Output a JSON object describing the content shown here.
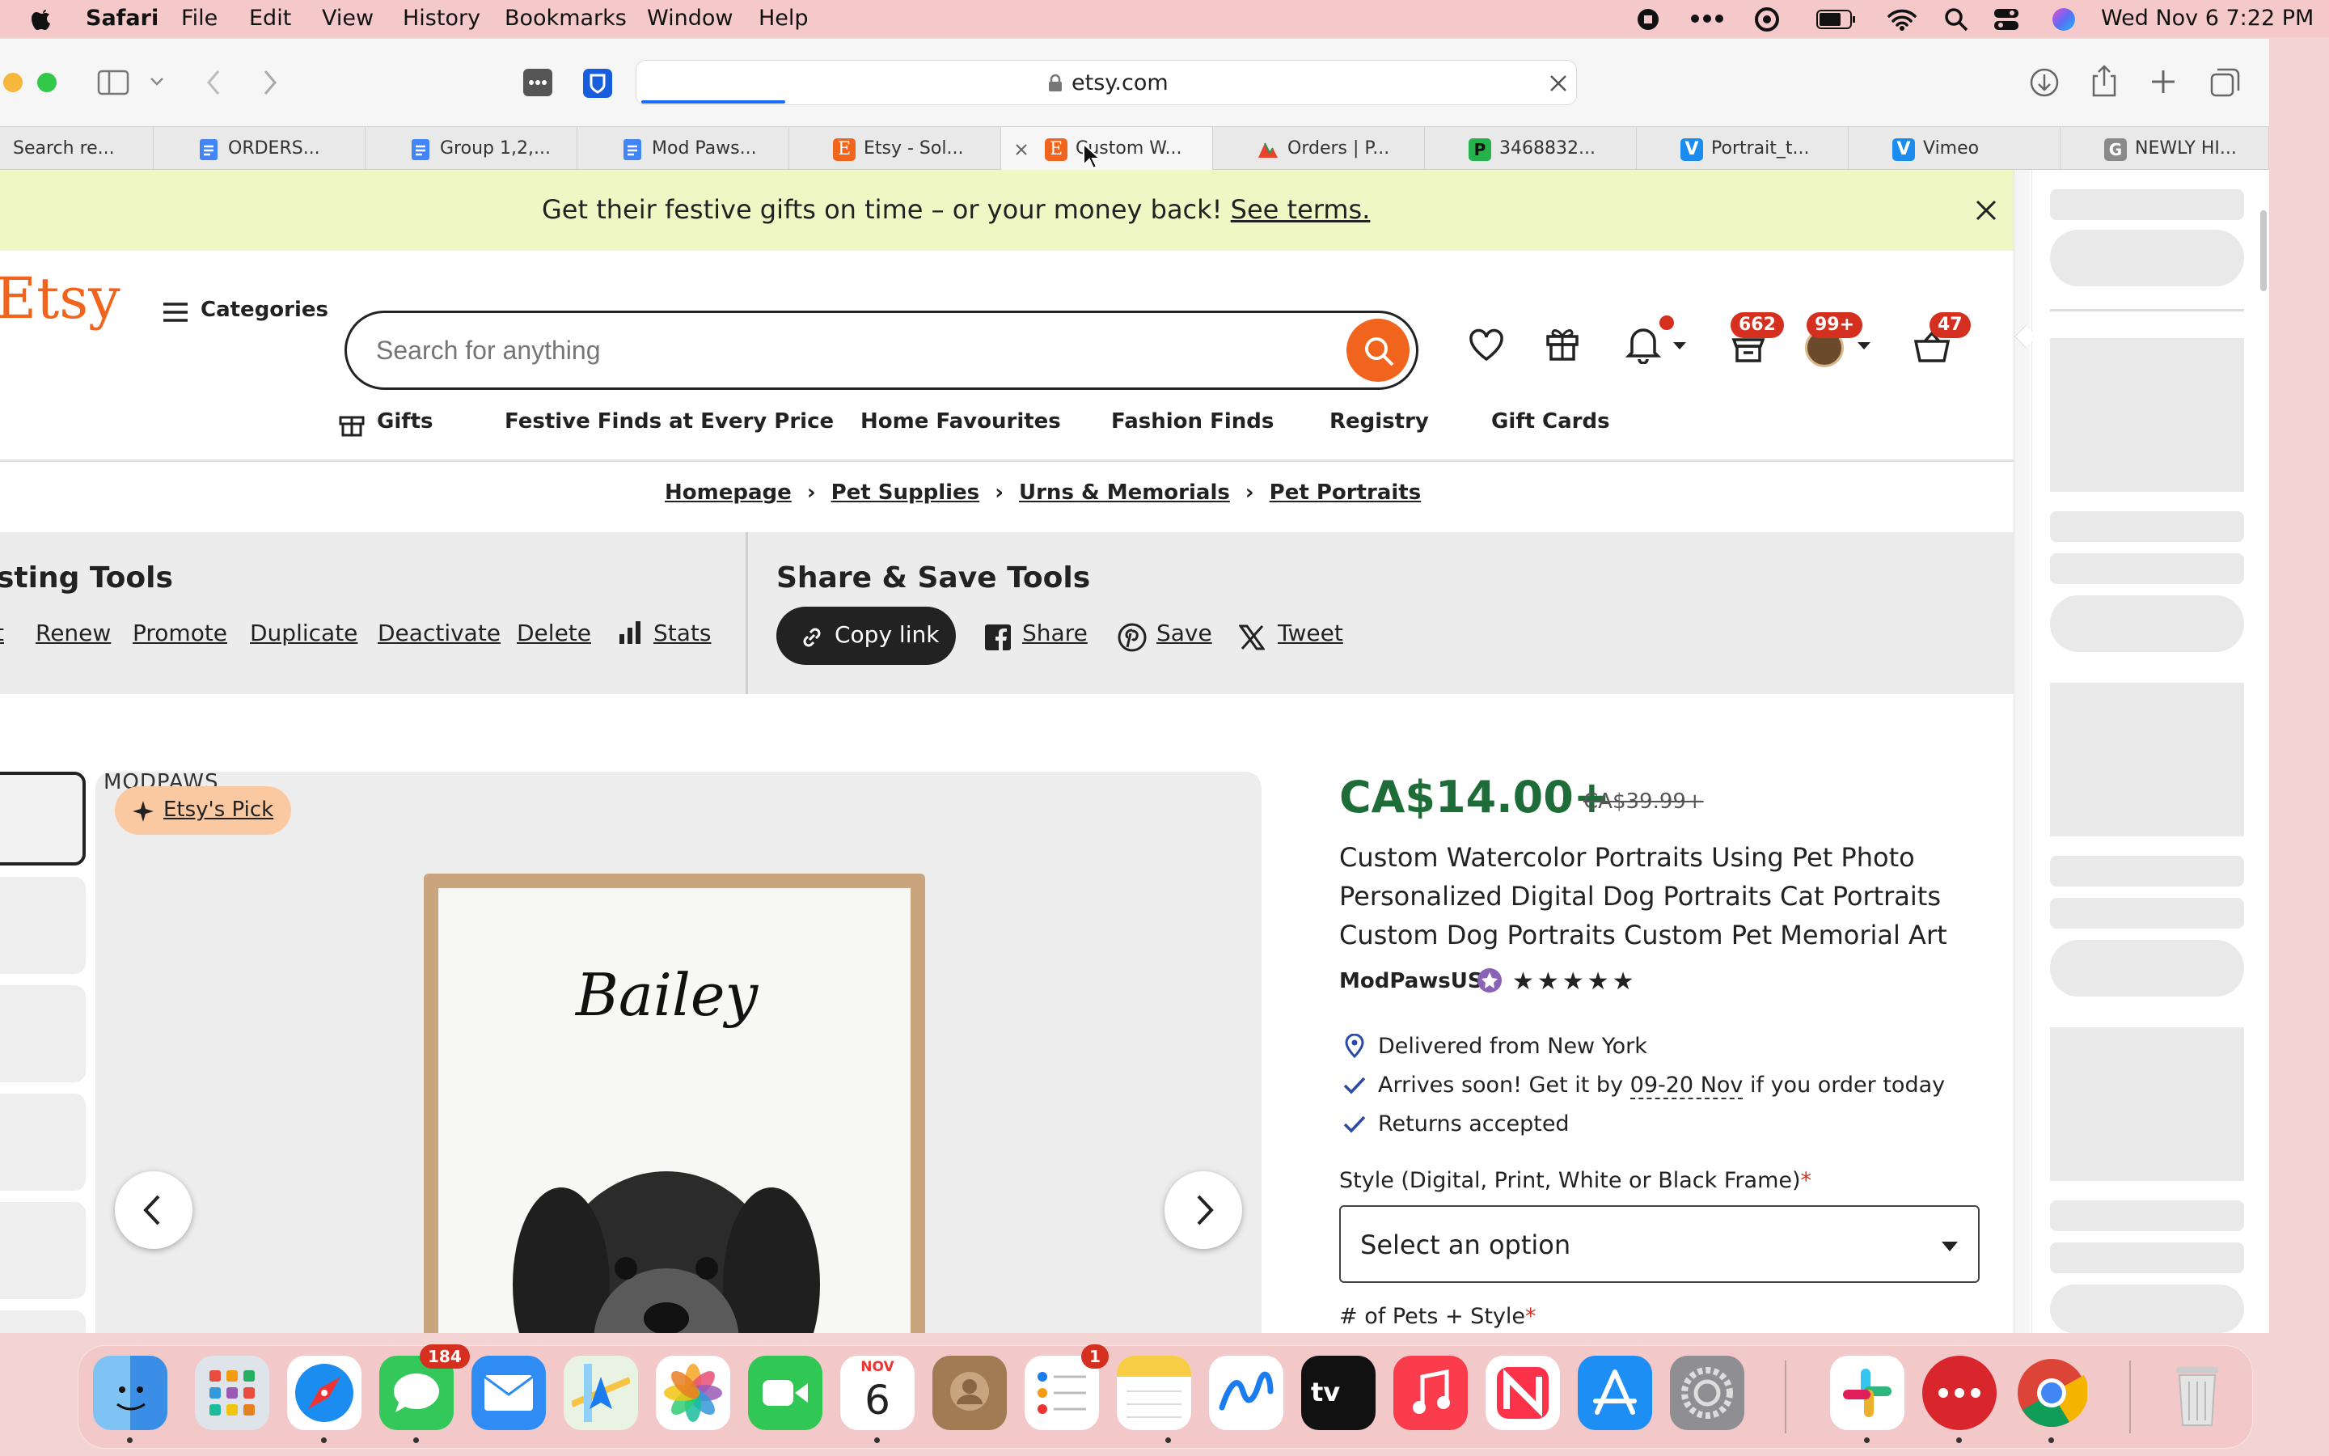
{
  "menubar": {
    "app": "Safari",
    "items": [
      "File",
      "Edit",
      "View",
      "History",
      "Bookmarks",
      "Window",
      "Help"
    ],
    "datetime": "Wed Nov 6  7:22 PM"
  },
  "browser": {
    "url": "etsy.com",
    "tabs": [
      {
        "label": "Search re...",
        "icon": "search-tab-icon"
      },
      {
        "label": "ORDERS...",
        "icon": "docs-icon"
      },
      {
        "label": "Group 1,2,...",
        "icon": "docs-icon"
      },
      {
        "label": "Mod Paws...",
        "icon": "docs-icon"
      },
      {
        "label": "Etsy - Sol...",
        "icon": "etsy-icon"
      },
      {
        "label": "Custom W...",
        "icon": "etsy-icon"
      },
      {
        "label": "Orders | P...",
        "icon": "printify-icon"
      },
      {
        "label": "3468832...",
        "icon": "p-icon"
      },
      {
        "label": "Portrait_t...",
        "icon": "vimeo-icon"
      },
      {
        "label": "Vimeo",
        "icon": "vimeo-icon"
      },
      {
        "label": "NEWLY HI...",
        "icon": "g-icon"
      }
    ]
  },
  "promo": {
    "text": "Get their festive gifts on time – or your money back!",
    "link": "See terms."
  },
  "header": {
    "logo": "Etsy",
    "categories": "Categories",
    "search_placeholder": "Search for anything",
    "badges": {
      "orders": "662",
      "messages": "99+",
      "cart": "47"
    }
  },
  "nav": [
    "Gifts",
    "Festive Finds at Every Price",
    "Home Favourites",
    "Fashion Finds",
    "Registry",
    "Gift Cards"
  ],
  "breadcrumb": [
    "Homepage",
    "Pet Supplies",
    "Urns & Memorials",
    "Pet Portraits"
  ],
  "listing_tools": {
    "title": "sting Tools",
    "links": [
      "t",
      "Renew",
      "Promote",
      "Duplicate",
      "Deactivate",
      "Delete"
    ],
    "stats": "Stats"
  },
  "share_tools": {
    "title": "Share & Save Tools",
    "copy": "Copy link",
    "share": "Share",
    "save": "Save",
    "tweet": "Tweet"
  },
  "gallery": {
    "shop_label": "MODPAWS",
    "etsy_pick": "Etsy's Pick",
    "pet_name": "Bailey"
  },
  "product": {
    "price": "CA$14.00+",
    "original_price": "CA$39.99+",
    "title_lines": [
      "Custom Watercolor Portraits Using Pet Photo",
      "Personalized Digital Dog Portraits Cat Portraits",
      "Custom Dog Portraits Custom Pet Memorial Art"
    ],
    "shop": "ModPawsUS",
    "rating": 5,
    "stars": "★★★★★",
    "delivered_from": "Delivered from New York",
    "arrives_pre": "Arrives soon! Get it by",
    "arrives_date": "09-20 Nov",
    "arrives_post": "if you order today",
    "returns": "Returns accepted",
    "style_label": "Style (Digital, Print, White or Black Frame)",
    "style_placeholder": "Select an option",
    "pets_label": "# of Pets + Style",
    "required_mark": "*"
  },
  "dock": {
    "messages_badge": "184",
    "reminders_badge": "1",
    "calendar_month": "NOV",
    "calendar_day": "6"
  },
  "colors": {
    "etsy_orange": "#f1641e",
    "price_green": "#1e6c37",
    "promo_bg": "#eff7c4",
    "badge_red": "#d5301f"
  }
}
